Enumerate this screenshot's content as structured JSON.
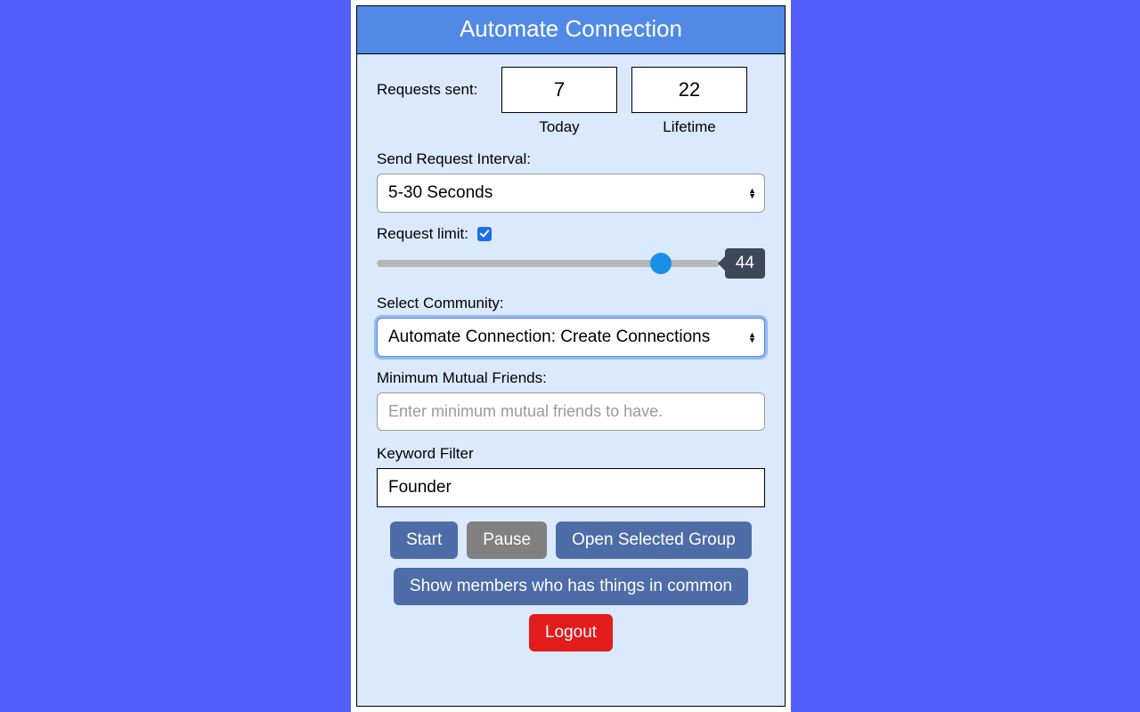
{
  "header": {
    "title": "Automate Connection"
  },
  "stats": {
    "label": "Requests sent:",
    "today_value": "7",
    "lifetime_value": "22",
    "today_caption": "Today",
    "lifetime_caption": "Lifetime"
  },
  "interval": {
    "label": "Send Request Interval:",
    "selected": "5-30 Seconds"
  },
  "request_limit": {
    "label": "Request limit:",
    "checked": true,
    "value": "44"
  },
  "community": {
    "label": "Select Community:",
    "selected": "Automate Connection: Create Connections"
  },
  "mutual": {
    "label": "Minimum Mutual Friends:",
    "placeholder": "Enter minimum mutual friends to have.",
    "value": ""
  },
  "keyword": {
    "label": "Keyword Filter",
    "value": "Founder"
  },
  "buttons": {
    "start": "Start",
    "pause": "Pause",
    "open_group": "Open Selected Group",
    "show_members": "Show members who has things in common",
    "logout": "Logout"
  }
}
